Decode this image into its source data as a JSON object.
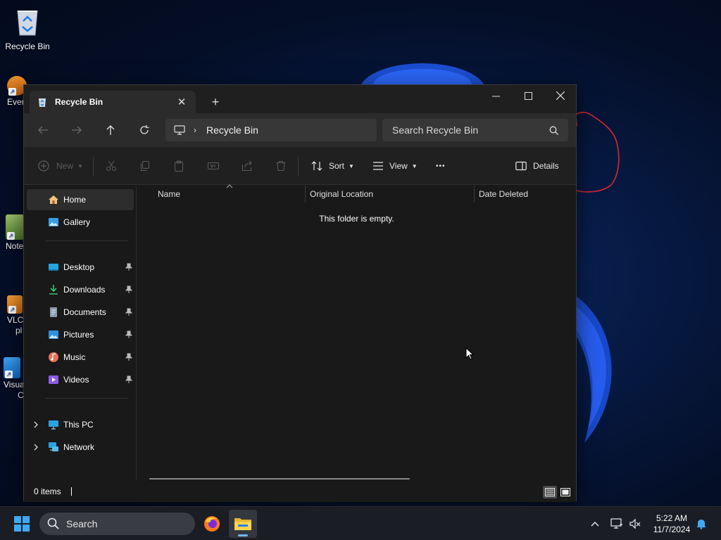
{
  "desktop": {
    "icons": [
      {
        "label": "Recycle Bin"
      },
      {
        "label": "Ever"
      },
      {
        "label": "Note"
      },
      {
        "label": "VLC"
      },
      {
        "label": "pl"
      },
      {
        "label": "Visua"
      },
      {
        "label": "C"
      }
    ]
  },
  "window": {
    "tab_title": "Recycle Bin",
    "close_tab_symbol": "✕",
    "new_tab_symbol": "+",
    "address": {
      "crumb": "Recycle Bin",
      "separator": "›"
    },
    "search": {
      "placeholder": "Search Recycle Bin"
    },
    "toolbar": {
      "new_label": "New",
      "sort_label": "Sort",
      "view_label": "View",
      "more_label": "•••",
      "details_label": "Details"
    },
    "sidebar": {
      "home": "Home",
      "gallery": "Gallery",
      "pinned": [
        {
          "label": "Desktop"
        },
        {
          "label": "Downloads"
        },
        {
          "label": "Documents"
        },
        {
          "label": "Pictures"
        },
        {
          "label": "Music"
        },
        {
          "label": "Videos"
        }
      ],
      "this_pc": "This PC",
      "network": "Network"
    },
    "columns": {
      "name": "Name",
      "original_location": "Original Location",
      "date_deleted": "Date Deleted"
    },
    "empty_message": "This folder is empty.",
    "status": {
      "item_count": "0 items"
    }
  },
  "taskbar": {
    "search_label": "Search",
    "time": "5:22 AM",
    "date": "11/7/2024"
  },
  "colors": {
    "window_bg": "#191919",
    "toolbar_bg": "#202020",
    "accent": "#6cb8f6",
    "annotation_red": "#e0252e"
  }
}
